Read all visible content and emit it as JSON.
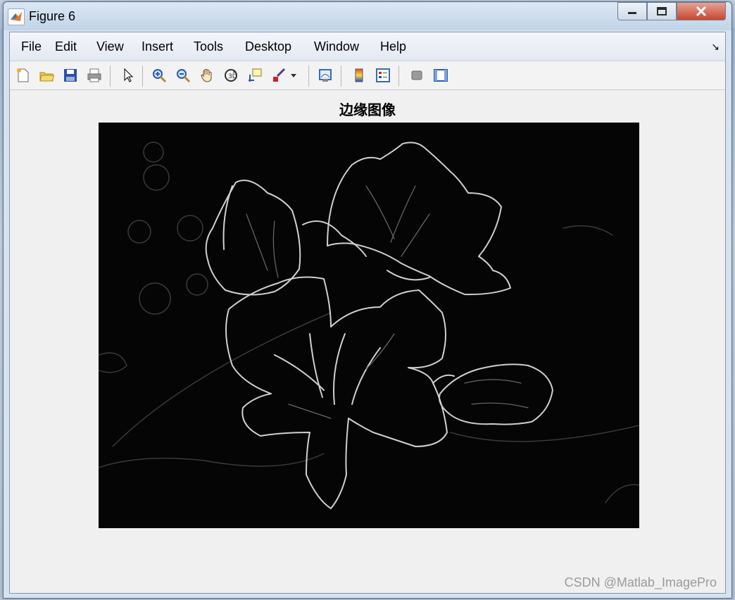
{
  "window": {
    "title": "Figure 6"
  },
  "menu": {
    "items": [
      "File",
      "Edit",
      "View",
      "Insert",
      "Tools",
      "Desktop",
      "Window",
      "Help"
    ]
  },
  "toolbar": {
    "icons": [
      "new-figure-icon",
      "open-file-icon",
      "save-icon",
      "print-icon",
      "pointer-icon",
      "zoom-in-icon",
      "zoom-out-icon",
      "pan-hand-icon",
      "rotate-3d-icon",
      "data-cursor-icon",
      "brush-icon",
      "link-plot-icon",
      "insert-colorbar-icon",
      "insert-legend-icon",
      "hide-plot-tools-icon",
      "show-plot-tools-icon"
    ]
  },
  "figure": {
    "title": "边缘图像"
  },
  "watermark": {
    "text": "CSDN @Matlab_ImagePro"
  },
  "colors": {
    "edge_line": "#d8d8d8",
    "axes_bg": "#050505",
    "close_button": "#c7472f"
  }
}
